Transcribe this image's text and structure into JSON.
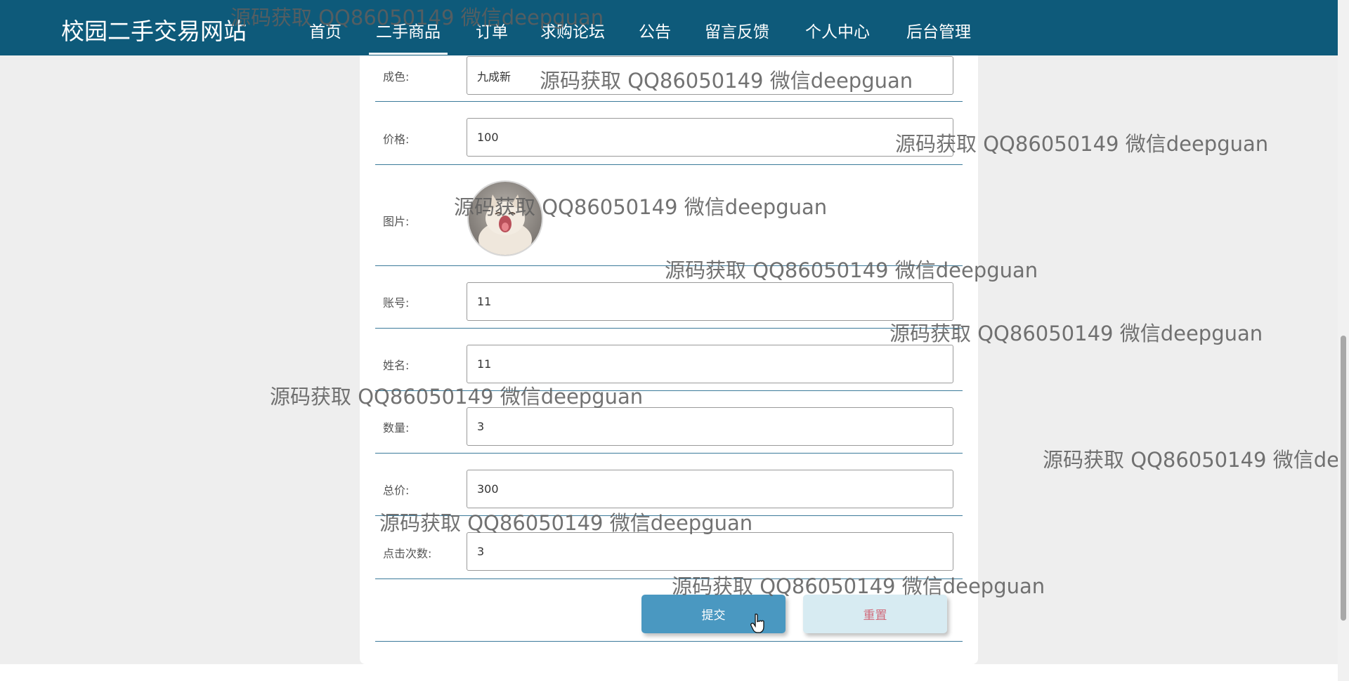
{
  "header": {
    "brand": "校园二手交易网站",
    "nav": [
      "首页",
      "二手商品",
      "订单",
      "求购论坛",
      "公告",
      "留言反馈",
      "个人中心",
      "后台管理"
    ],
    "active_index": 1
  },
  "form": {
    "condition_label": "成色:",
    "condition_value": "九成新",
    "price_label": "价格:",
    "price_value": "100",
    "image_label": "图片:",
    "account_label": "账号:",
    "account_value": "11",
    "name_label": "姓名:",
    "name_value": "11",
    "quantity_label": "数量:",
    "quantity_value": "3",
    "total_label": "总价:",
    "total_value": "300",
    "clicks_label": "点击次数:",
    "clicks_value": "3",
    "submit_label": "提交",
    "reset_label": "重置"
  },
  "watermark": "源码获取 QQ86050149 微信deepguan",
  "colors": {
    "navbar": "#0e5a7a",
    "submit": "#4a98c1",
    "reset_bg": "#d7ebf2",
    "reset_text": "#d06a7a"
  }
}
